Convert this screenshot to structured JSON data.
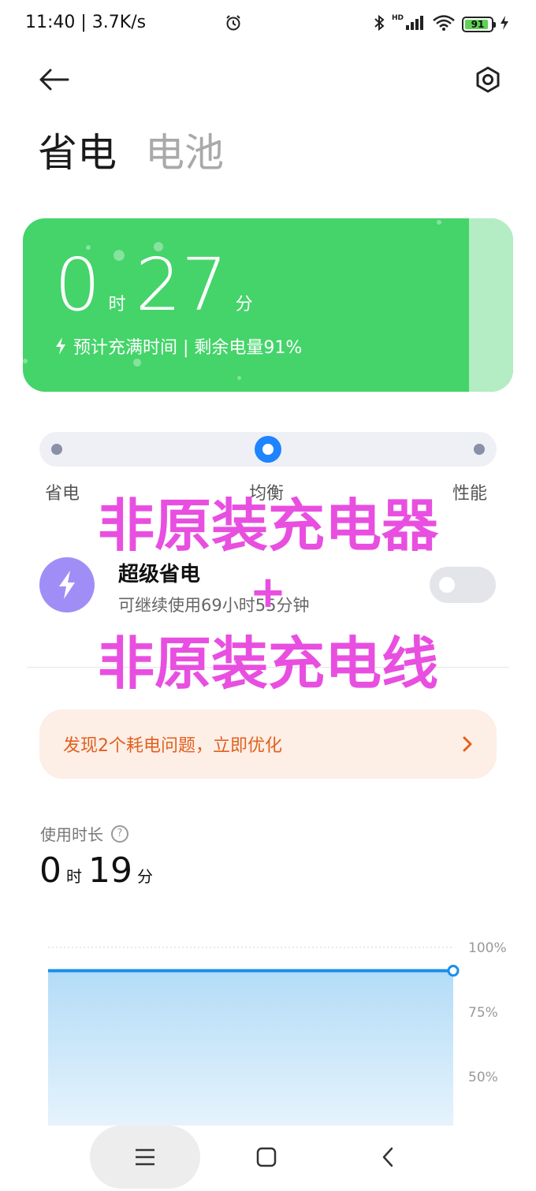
{
  "status_bar": {
    "time": "11:40 | 3.7K/s",
    "hd": "HD",
    "battery_level": 91,
    "battery_text": "91"
  },
  "icons": {
    "back": "back-arrow-icon",
    "settings": "settings-icon",
    "bolt": "lightning-icon",
    "help": "help-icon"
  },
  "tabs": [
    {
      "label": "省电",
      "active": true
    },
    {
      "label": "电池",
      "active": false
    }
  ],
  "charge_card": {
    "hours": "0",
    "hours_unit": "时",
    "minutes": "27",
    "minutes_unit": "分",
    "subtitle": "预计充满时间 | 剩余电量91%",
    "color": "#44d46a"
  },
  "power_mode": {
    "options": [
      "省电",
      "均衡",
      "性能"
    ],
    "selected": "均衡",
    "accent": "#1f84ff"
  },
  "super_saver": {
    "title": "超级省电",
    "subtitle": "可继续使用69小时55分钟",
    "enabled": false
  },
  "issue_banner": {
    "text": "发现2个耗电问题，立即优化",
    "color": "#e0611f"
  },
  "usage": {
    "label": "使用时长",
    "help": "?",
    "hours": "0",
    "hours_unit": "时",
    "minutes": "19",
    "minutes_unit": "分"
  },
  "battery_chart": {
    "y_labels": [
      "100%",
      "75%",
      "50%"
    ],
    "level_percent": 91,
    "line_color": "#1a8ee8"
  },
  "watermark": {
    "line1": "非原装充电器",
    "plus": "+",
    "line2": "非原装充电线"
  },
  "nav": {
    "menu": "menu-icon",
    "home": "home-icon",
    "back": "back-chevron-icon"
  }
}
